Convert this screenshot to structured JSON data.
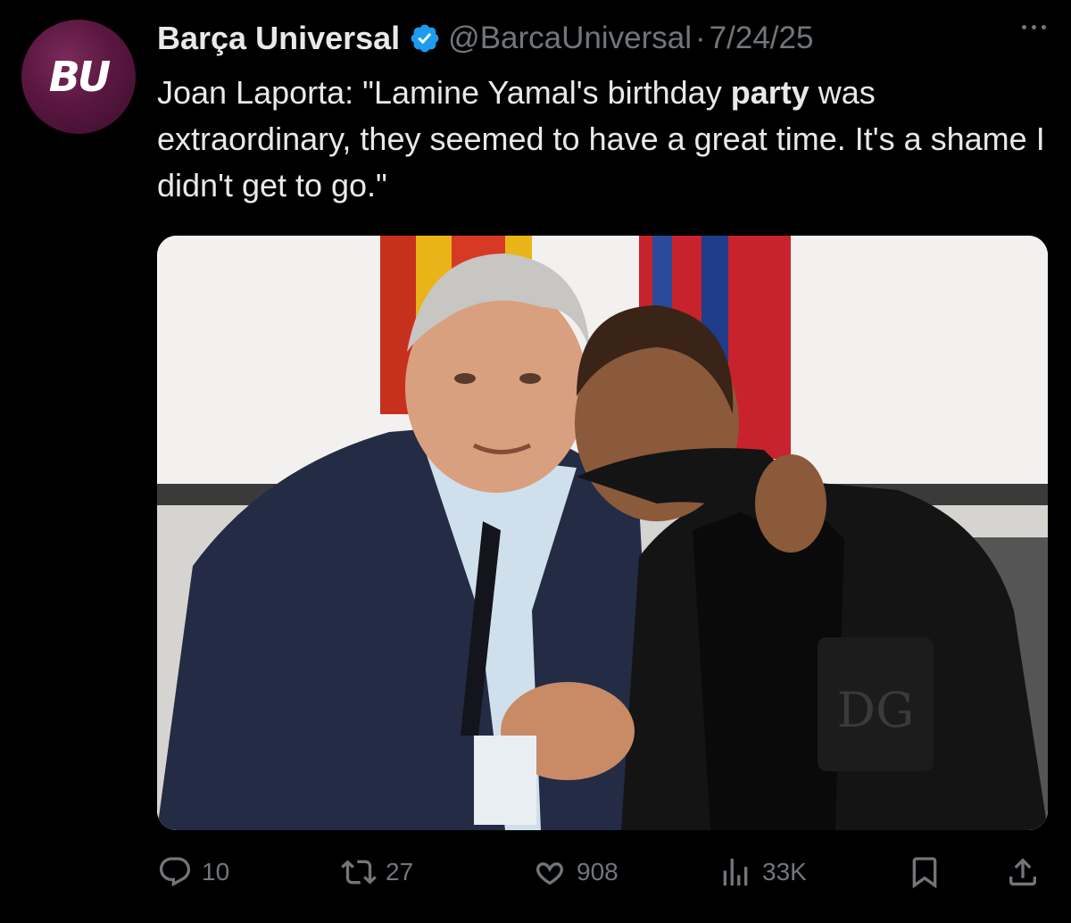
{
  "tweet": {
    "avatar_text": "BU",
    "display_name": "Barça Universal",
    "handle": "@BarcaUniversal",
    "separator": "·",
    "date": "7/24/25",
    "text_before": "Joan Laporta: \"Lamine Yamal's birthday ",
    "text_bold": "party",
    "text_after": " was extraordinary, they seemed to have a great time. It's a shame I didn't get to go.\"",
    "media_badge": "DG"
  },
  "actions": {
    "replies": "10",
    "reposts": "27",
    "likes": "908",
    "views": "33K"
  },
  "icons": {
    "verified": "verified-badge-icon",
    "more": "more-options-icon",
    "reply": "reply-icon",
    "repost": "repost-icon",
    "like": "heart-icon",
    "views": "views-chart-icon",
    "bookmark": "bookmark-icon",
    "share": "share-icon"
  },
  "colors": {
    "background": "#000000",
    "text_primary": "#e7e9ea",
    "text_secondary": "#71767b",
    "verified_blue": "#1d9bf0",
    "avatar_maroon": "#5a1740"
  }
}
